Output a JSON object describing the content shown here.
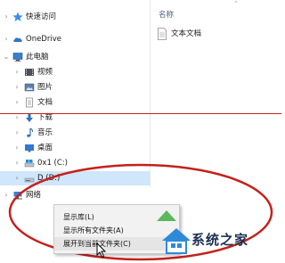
{
  "nav": {
    "items": [
      {
        "label": "快速访问",
        "icon": "star-icon",
        "chevron": "›"
      },
      {
        "label": "OneDrive",
        "icon": "cloud-icon",
        "chevron": "›"
      },
      {
        "label": "此电脑",
        "icon": "computer-icon",
        "chevron": "⌄"
      },
      {
        "label": "视频",
        "icon": "video-icon",
        "chevron": "›"
      },
      {
        "label": "图片",
        "icon": "pictures-icon",
        "chevron": "›"
      },
      {
        "label": "文档",
        "icon": "documents-icon",
        "chevron": "›"
      },
      {
        "label": "下载",
        "icon": "download-icon",
        "chevron": "›"
      },
      {
        "label": "音乐",
        "icon": "music-icon",
        "chevron": "›"
      },
      {
        "label": "桌面",
        "icon": "desktop-icon",
        "chevron": "›"
      },
      {
        "label": "0x1 (C:)",
        "icon": "drive-icon",
        "chevron": "›"
      },
      {
        "label": "D (D:)",
        "icon": "drive-icon",
        "chevron": "›"
      },
      {
        "label": "网络",
        "icon": "network-icon",
        "chevron": "›"
      }
    ]
  },
  "content": {
    "column_header": "名称",
    "files": [
      {
        "label": "文本文档",
        "icon": "text-file-icon"
      }
    ]
  },
  "context_menu": {
    "items": [
      {
        "label": "显示库(L)"
      },
      {
        "label": "显示所有文件夹(A)"
      },
      {
        "label": "展开到当前文件夹(C)"
      }
    ]
  },
  "watermark": {
    "text": "系统之家"
  },
  "colors": {
    "selection": "#cfe6fb",
    "annotation": "#c5201a"
  }
}
